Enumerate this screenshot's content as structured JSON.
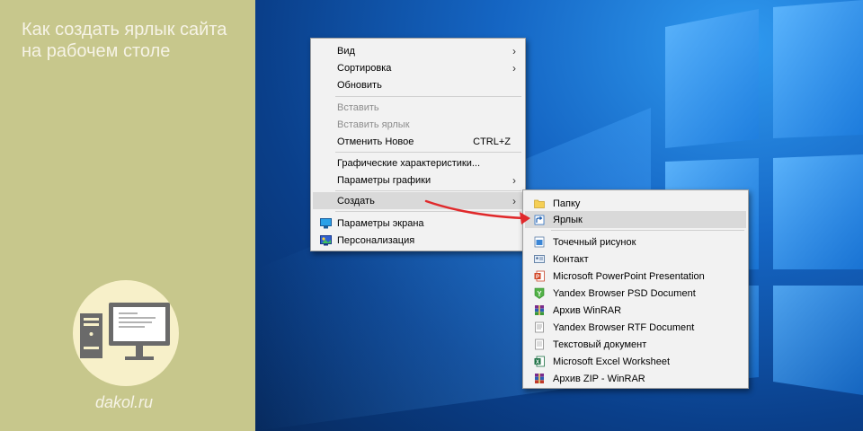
{
  "left_panel": {
    "title": "Как создать ярлык сайта\nна рабочем столе",
    "site": "dakol.ru",
    "colors": {
      "background": "#c7c78c",
      "circle": "#f7f0c9",
      "monitor": "#6a6a6a"
    }
  },
  "context_menu": {
    "view": "Вид",
    "sort": "Сортировка",
    "refresh": "Обновить",
    "paste": "Вставить",
    "paste_shortcut": "Вставить ярлык",
    "undo_new": "Отменить Новое",
    "undo_new_shortcut": "CTRL+Z",
    "graphics_properties": "Графические характеристики...",
    "graphics_options": "Параметры графики",
    "create": "Создать",
    "display_settings": "Параметры экрана",
    "personalize": "Персонализация"
  },
  "submenu": {
    "items": [
      {
        "label": "Папку",
        "icon": "folder-icon"
      },
      {
        "label": "Ярлык",
        "icon": "shortcut-icon"
      },
      {
        "label": "Точечный рисунок",
        "icon": "bitmap-icon"
      },
      {
        "label": "Контакт",
        "icon": "contact-icon"
      },
      {
        "label": "Microsoft PowerPoint Presentation",
        "icon": "powerpoint-icon"
      },
      {
        "label": "Yandex Browser PSD Document",
        "icon": "yandex-psd-icon"
      },
      {
        "label": "Архив WinRAR",
        "icon": "winrar-icon"
      },
      {
        "label": "Yandex Browser RTF Document",
        "icon": "yandex-rtf-icon"
      },
      {
        "label": "Текстовый документ",
        "icon": "text-document-icon"
      },
      {
        "label": "Microsoft Excel Worksheet",
        "icon": "excel-icon"
      },
      {
        "label": "Архив ZIP - WinRAR",
        "icon": "zip-winrar-icon"
      }
    ]
  },
  "colors": {
    "menu_bg": "#f2f2f2",
    "highlight": "#d9d9d9",
    "arrow": "#e0292b",
    "desktop": "#1566c4"
  }
}
